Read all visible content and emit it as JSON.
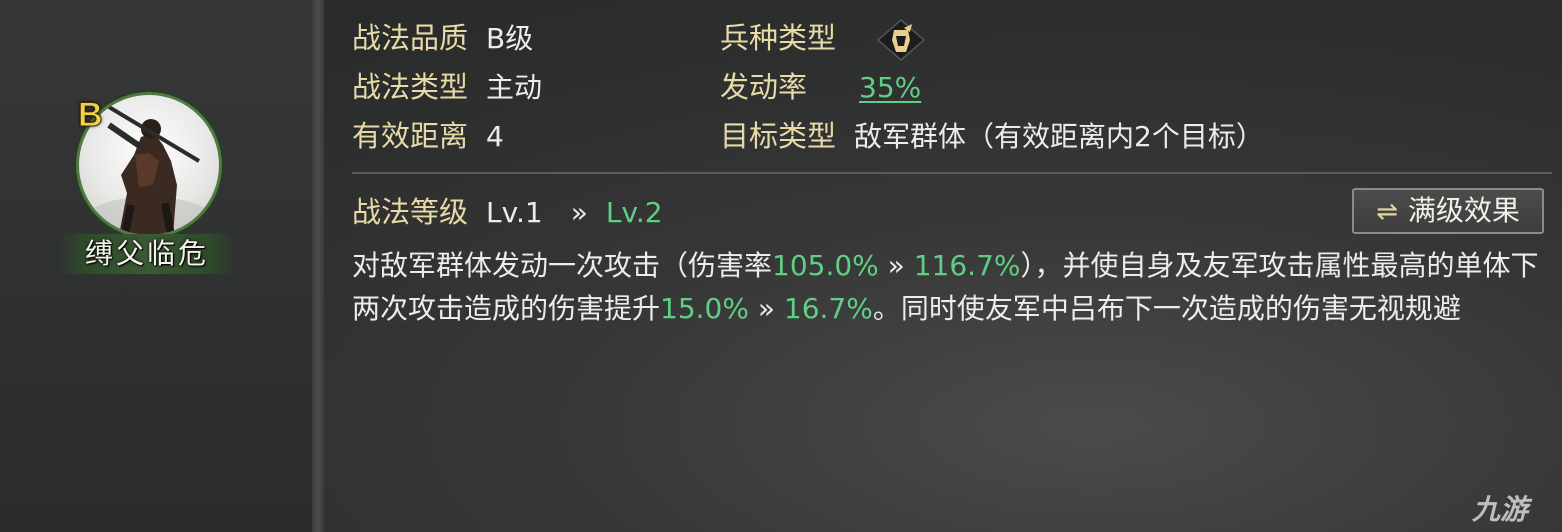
{
  "skill": {
    "name": "缚父临危",
    "grade_badge": "B"
  },
  "attributes": {
    "quality_label": "战法品质",
    "quality_value": "B级",
    "type_label": "战法类型",
    "type_value": "主动",
    "range_label": "有效距离",
    "range_value": "4",
    "troop_label": "兵种类型",
    "troop_icon": "cavalry-helmet-icon",
    "rate_label": "发动率",
    "rate_value": "35%",
    "target_label": "目标类型",
    "target_value": "敌军群体（有效距离内2个目标）"
  },
  "level": {
    "label": "战法等级",
    "current": "Lv.1",
    "arrow": "»",
    "next": "Lv.2"
  },
  "max_button": {
    "icon": "⇌",
    "label": "满级效果"
  },
  "description": {
    "p1": "对敌军群体发动一次攻击（伤害率",
    "dmg_from": "105.0%",
    "arrow1": " » ",
    "dmg_to": "116.7%",
    "p2": "），并使自身及友军攻击属性最高的单体下两次攻击造成的伤害提升",
    "boost_from": "15.0%",
    "arrow2": " » ",
    "boost_to": "16.7%",
    "p3": "。同时使友军中吕布下一次造成的伤害无视规避"
  },
  "watermark": "九游",
  "colors": {
    "accent_green": "#5fcf86",
    "label_gold": "#e8d9a8",
    "badge_yellow": "#f1d14a"
  }
}
